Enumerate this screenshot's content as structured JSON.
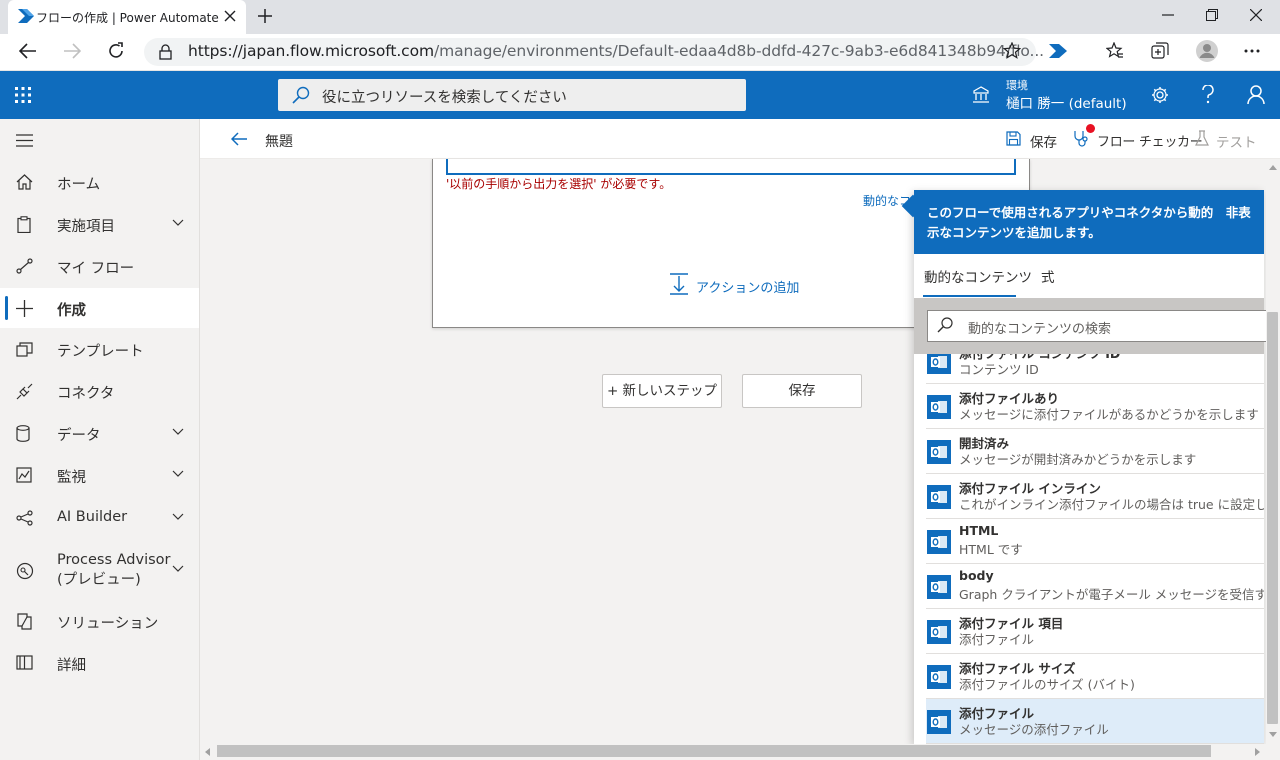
{
  "browser": {
    "tab_title": "フローの作成 | Power Automate",
    "url_main": "https://japan.flow.microsoft.com",
    "url_rest": "/manage/environments/Default-edaa4d8b-ddfd-427c-9ab3-e6d841348b94/flo..."
  },
  "header": {
    "search_placeholder": "役に立つリソースを検索してください",
    "env_label": "環境",
    "env_name": "樋口 勝一 (default)"
  },
  "sidebar": {
    "items": [
      {
        "label": "ホーム"
      },
      {
        "label": "実施項目"
      },
      {
        "label": "マイ フロー"
      },
      {
        "label": "作成"
      },
      {
        "label": "テンプレート"
      },
      {
        "label": "コネクタ"
      },
      {
        "label": "データ"
      },
      {
        "label": "監視"
      },
      {
        "label": "AI Builder"
      },
      {
        "label": "Process Advisor"
      },
      {
        "label": "ソリューション"
      },
      {
        "label": "詳細"
      }
    ],
    "process_advisor_sub": "(プレビュー)"
  },
  "commandbar": {
    "title": "無題",
    "save": "保存",
    "checker": "フロー チェッカー",
    "test": "テスト"
  },
  "canvas": {
    "error_text": "'以前の手順から出力を選択' が必要です。",
    "dynamic_link": "動的なコンテンツの追加",
    "add_action": "アクションの追加",
    "new_step": "+ 新しいステップ",
    "save": "保存"
  },
  "panel": {
    "header": "このフローで使用されるアプリやコネクタから動的　非表示なコンテンツを追加します。",
    "tab_dynamic": "動的なコンテンツ",
    "tab_expression": "式",
    "search_placeholder": "動的なコンテンツの検索",
    "items": [
      {
        "title": "添付ファイル コンテンツ ID",
        "desc": "コンテンツ ID"
      },
      {
        "title": "添付ファイルあり",
        "desc": "メッセージに添付ファイルがあるかどうかを示します"
      },
      {
        "title": "開封済み",
        "desc": "メッセージが開封済みかどうかを示します"
      },
      {
        "title": "添付ファイル インライン",
        "desc": "これがインライン添付ファイルの場合は true に設定します"
      },
      {
        "title": "HTML",
        "desc": "HTML です"
      },
      {
        "title": "body",
        "desc": "Graph クライアントが電子メール メッセージを受信する"
      },
      {
        "title": "添付ファイル 項目",
        "desc": "添付ファイル"
      },
      {
        "title": "添付ファイル サイズ",
        "desc": "添付ファイルのサイズ (バイト)"
      },
      {
        "title": "添付ファイル",
        "desc": "メッセージの添付ファイル"
      }
    ]
  },
  "colors": {
    "accent": "#0f6cbd",
    "error": "#a80000",
    "selected": "#deecf9"
  }
}
